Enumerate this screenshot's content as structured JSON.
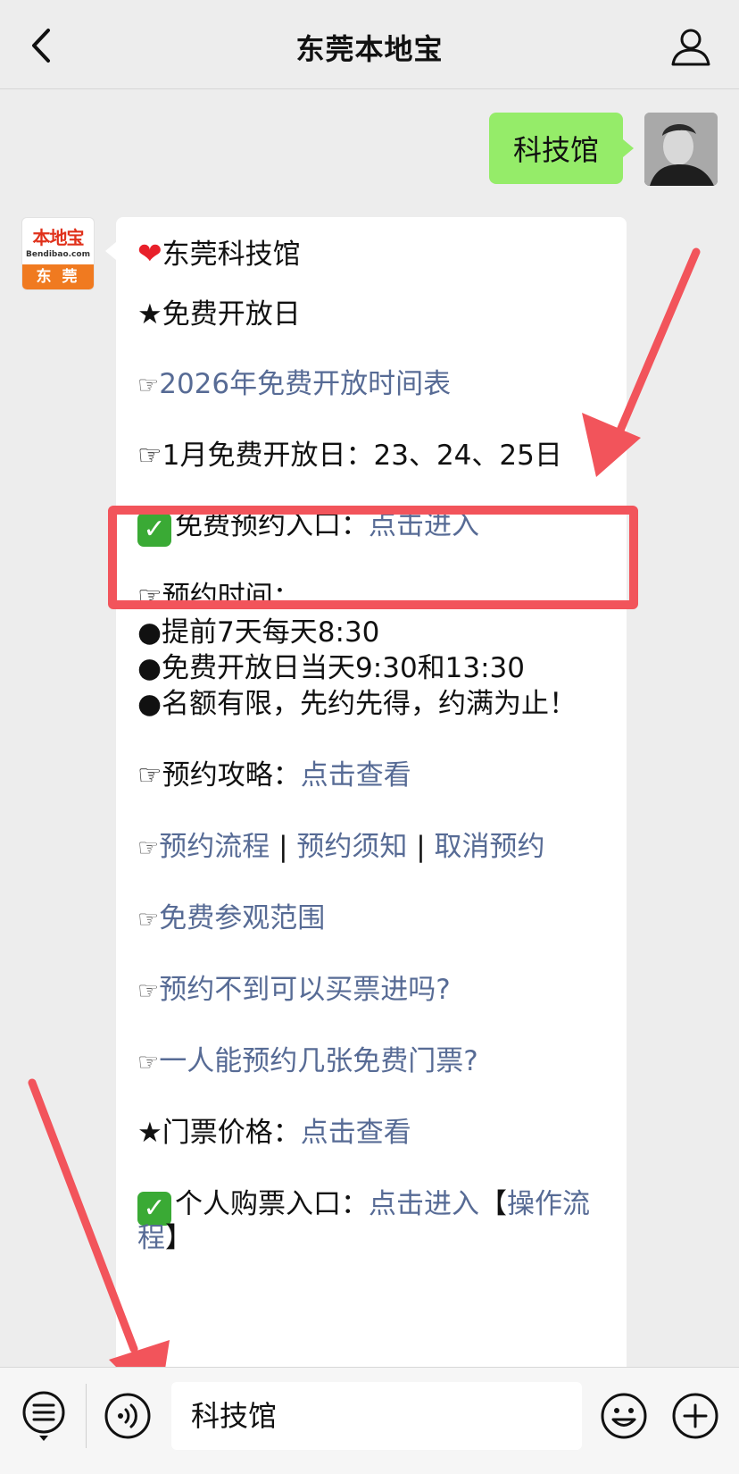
{
  "header": {
    "title": "东莞本地宝"
  },
  "user_message": {
    "text": "科技馆"
  },
  "bot_avatar": {
    "logo_text": "本地宝",
    "domain": "Bendibao.com",
    "city": "东 莞"
  },
  "bot_message": {
    "title": "东莞科技馆",
    "free_day_heading": "★免费开放日",
    "schedule_pointer": "☞",
    "schedule_link": "2026年免费开放时间表",
    "january_text": "☞1月免费开放日：23、24、25日",
    "booking_label": "免费预约入口：",
    "booking_link": "点击进入",
    "booking_time_heading": "☞预约时间：",
    "booking_time_lines": [
      "●提前7天每天8:30",
      "●免费开放日当天9:30和13:30",
      "●名额有限，先约先得，约满为止！"
    ],
    "guide_label": "☞预约攻略：",
    "guide_link": "点击查看",
    "process_pointer": "☞",
    "process_link": "预约流程",
    "notice_link": "预约须知",
    "cancel_link": "取消预约",
    "separator": " | ",
    "scope_pointer": "☞",
    "scope_link": "免费参观范围",
    "ticket_q_pointer": "☞",
    "ticket_q_link": "预约不到可以买票进吗?",
    "count_q_pointer": "☞",
    "count_q_link": "一人能预约几张免费门票?",
    "price_label": "★门票价格：",
    "price_link": "点击查看",
    "purchase_label": "个人购票入口：",
    "purchase_link": "点击进入",
    "purchase_bracket_open": "【",
    "purchase_process_link_1": "操作流",
    "purchase_process_link_2": "程",
    "purchase_bracket_close": "】"
  },
  "input_bar": {
    "value": "科技馆"
  },
  "colors": {
    "background": "#ededed",
    "user_bubble": "#95ec69",
    "link": "#576b95",
    "highlight": "#f2545b",
    "arrow": "#f2545b"
  },
  "icons": [
    "back-chevron-icon",
    "profile-icon",
    "menu-list-icon",
    "voice-icon",
    "emoji-icon",
    "plus-icon",
    "heart-icon",
    "check-icon"
  ]
}
